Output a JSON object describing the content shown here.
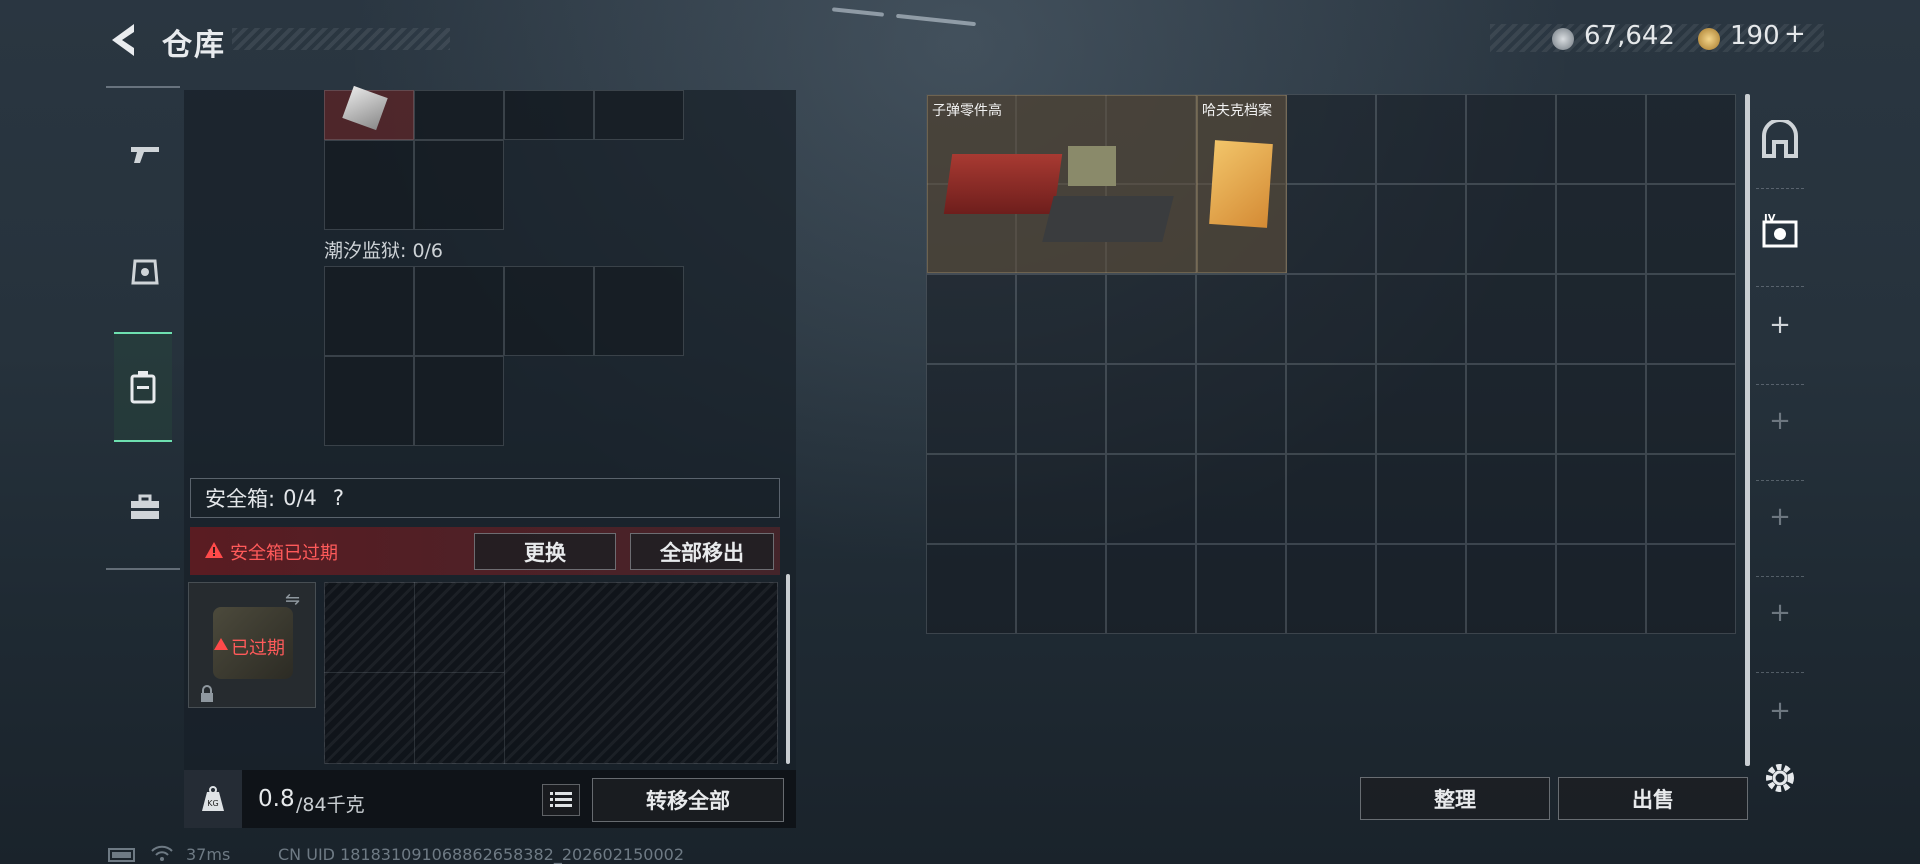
{
  "header": {
    "title": "仓库",
    "currency_silver": "67,642",
    "currency_gold": "190",
    "add_label": "+"
  },
  "left": {
    "prison_label": "潮汐监狱: 0/6",
    "safebox_label": "安全箱:",
    "safebox_count": "0/4",
    "safebox_help": "?",
    "expired_warning": "安全箱已过期",
    "replace_button": "更换",
    "move_all_out_button": "全部移出",
    "expired_tag": "已过期",
    "weight_icon_label": "KG",
    "weight_current": "0.8",
    "weight_total": "/84千克",
    "transfer_all_button": "转移全部"
  },
  "right": {
    "items": [
      {
        "name": "子弹零件高"
      },
      {
        "name": "哈夫克档案"
      }
    ],
    "sort_button": "整理",
    "sell_button": "出售"
  },
  "status": {
    "ping": "37ms",
    "uid": "CN UID 18183109106886265838​2_202602150002"
  },
  "colors": {
    "accent_green": "#6ee0b0",
    "warning_red": "#ff5a5a"
  }
}
